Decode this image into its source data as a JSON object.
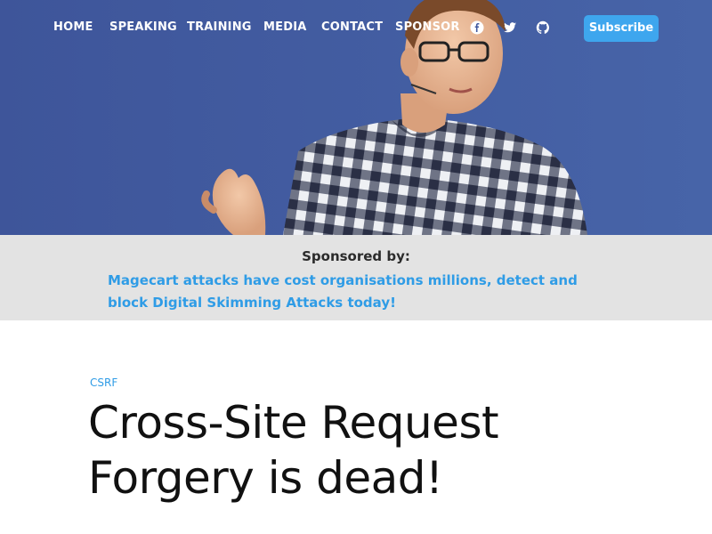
{
  "nav": {
    "items": [
      {
        "label": "HOME"
      },
      {
        "label": "SPEAKING"
      },
      {
        "label": "TRAINING"
      },
      {
        "label": "MEDIA"
      },
      {
        "label": "CONTACT"
      },
      {
        "label": "SPONSOR"
      }
    ],
    "social_icons": [
      "facebook-icon",
      "twitter-icon",
      "github-icon"
    ],
    "subscribe_label": "Subscribe"
  },
  "sponsor": {
    "label": "Sponsored by:",
    "link_text": "Magecart attacks have cost organisations millions, detect and block Digital Skimming Attacks today!"
  },
  "article": {
    "category": "CSRF",
    "title": "Cross-Site Request Forgery is dead!"
  },
  "colors": {
    "accent": "#3ea6ee",
    "link": "#2f9ce6",
    "sponsor_bg": "#e3e3e3",
    "hero_bg": "#3f5aa0",
    "title_text": "#111111"
  }
}
